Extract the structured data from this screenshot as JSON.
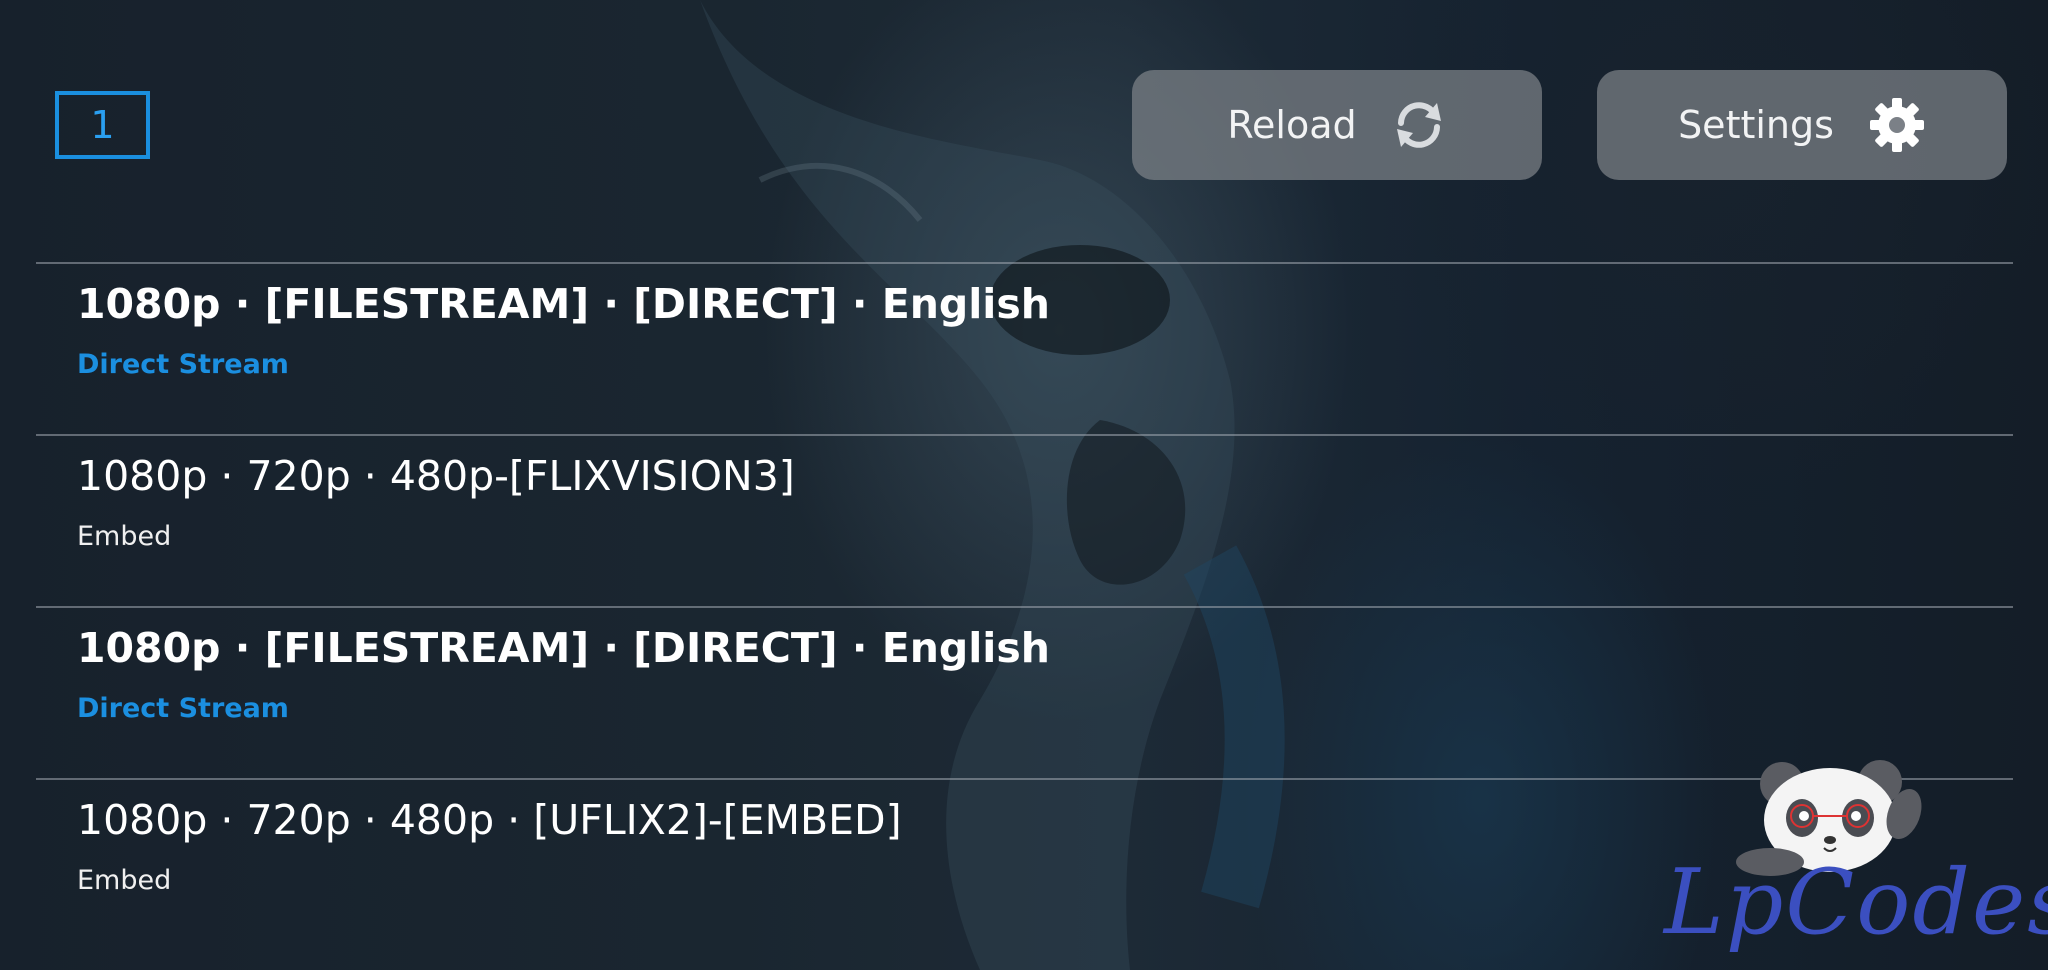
{
  "page_indicator": "1",
  "toolbar": {
    "reload_label": "Reload",
    "reload_icon": "refresh-icon",
    "settings_label": "Settings",
    "settings_icon": "gear-icon"
  },
  "streams": [
    {
      "title": "1080p · [FILESTREAM] · [DIRECT] · English",
      "subtitle": "Direct Stream",
      "bold": true
    },
    {
      "title": "1080p · 720p · 480p-[FLIXVISION3]",
      "subtitle": "Embed",
      "bold": false
    },
    {
      "title": "1080p · [FILESTREAM] · [DIRECT] · English",
      "subtitle": "Direct Stream",
      "bold": true
    },
    {
      "title": "1080p · 720p · 480p · [UFLIX2]-[EMBED]",
      "subtitle": "Embed",
      "bold": false
    }
  ],
  "watermark": {
    "text": "LpCodes",
    "icon": "panda-mascot"
  },
  "colors": {
    "accent": "#1a8fdf",
    "button_bg": "#7d8288",
    "background": "#17212c",
    "watermark": "#3b4fc0"
  }
}
